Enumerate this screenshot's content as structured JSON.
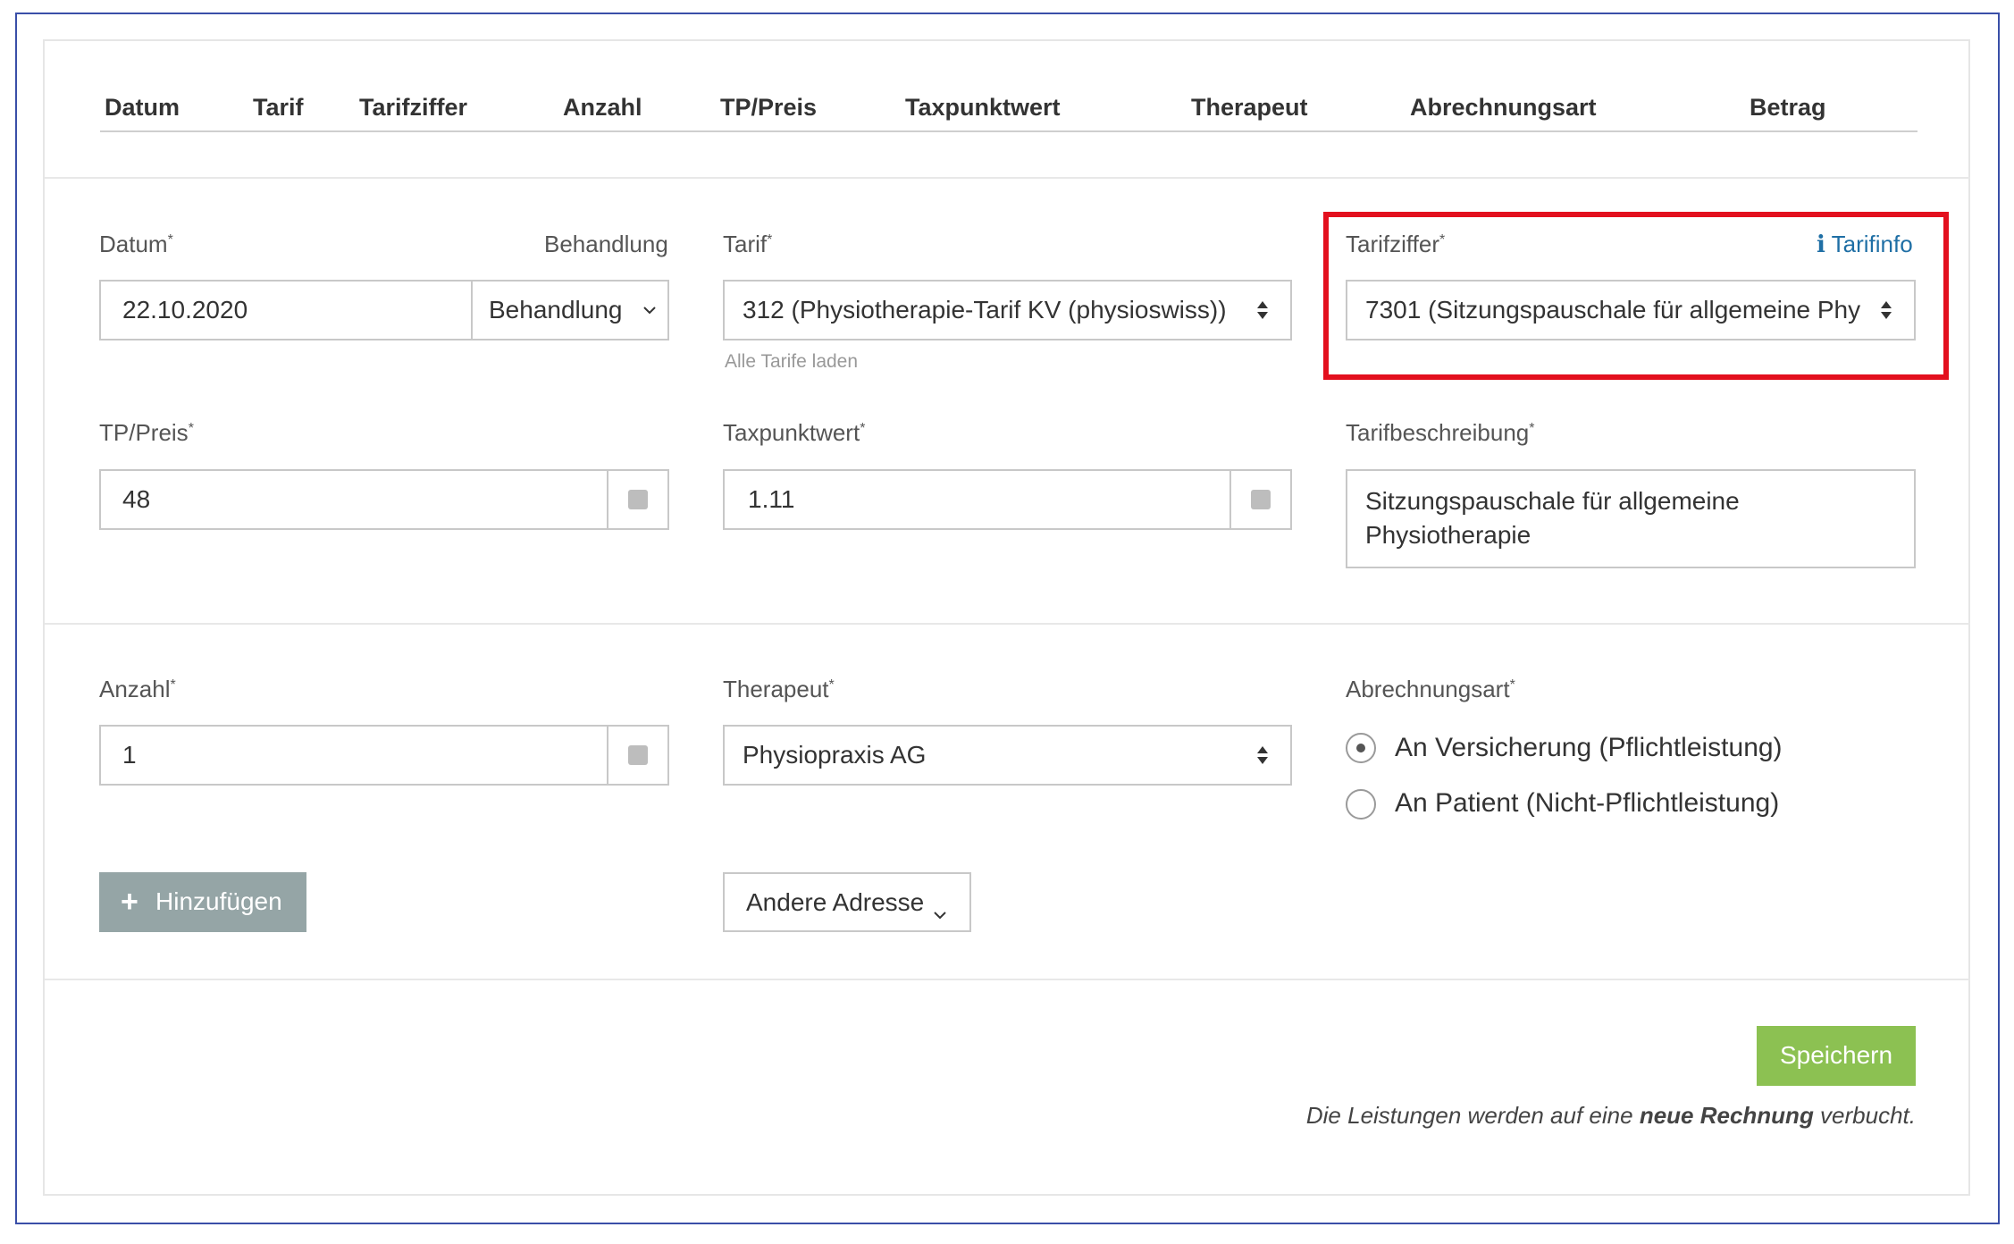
{
  "table_header": {
    "columns": [
      "Datum",
      "Tarif",
      "Tarifziffer",
      "Anzahl",
      "TP/Preis",
      "Taxpunktwert",
      "Therapeut",
      "Abrechnungsart",
      "Betrag"
    ]
  },
  "form": {
    "datum": {
      "label": "Datum",
      "required_mark": "*",
      "value": "22.10.2020"
    },
    "behandlung": {
      "label": "Behandlung",
      "button_label": "Behandlung"
    },
    "tarif": {
      "label": "Tarif",
      "required_mark": "*",
      "value": "312 (Physiotherapie-Tarif KV (physioswiss))",
      "link_load_all": "Alle Tarife laden"
    },
    "tarifziffer": {
      "label": "Tarifziffer",
      "required_mark": "*",
      "info_link": "Tarifinfo",
      "value": "7301 (Sitzungspauschale für allgemeine Phy"
    },
    "tp_preis": {
      "label": "TP/Preis",
      "required_mark": "*",
      "value": "48"
    },
    "taxpunktwert": {
      "label": "Taxpunktwert",
      "required_mark": "*",
      "value": "1.11"
    },
    "tarifbeschreibung": {
      "label": "Tarifbeschreibung",
      "required_mark": "*",
      "value_line1": "Sitzungspauschale für allgemeine",
      "value_line2": "Physiotherapie"
    },
    "anzahl": {
      "label": "Anzahl",
      "required_mark": "*",
      "value": "1"
    },
    "therapeut": {
      "label": "Therapeut",
      "required_mark": "*",
      "value": "Physiopraxis AG"
    },
    "abrechnungsart": {
      "label": "Abrechnungsart",
      "required_mark": "*",
      "options": [
        {
          "label": "An Versicherung (Pflichtleistung)",
          "selected": true
        },
        {
          "label": "An Patient (Nicht-Pflichtleistung)",
          "selected": false
        }
      ]
    },
    "add_button": {
      "label": "Hinzufügen"
    },
    "address_button": {
      "label": "Andere Adresse"
    }
  },
  "footer": {
    "save_label": "Speichern",
    "note_pre": "Die Leistungen werden auf eine ",
    "note_bold": "neue Rechnung",
    "note_post": " verbucht."
  },
  "colors": {
    "accent_link": "#1f6fa5",
    "save_green": "#8cc152",
    "add_grey": "#95a5a6",
    "highlight_red": "#e3101e",
    "frame_blue": "#3a4fa8"
  },
  "icons": {
    "info": "info-icon",
    "chevron": "chevron-down-icon",
    "select_arrows": "sort-arrows-icon",
    "plus": "plus-icon"
  }
}
